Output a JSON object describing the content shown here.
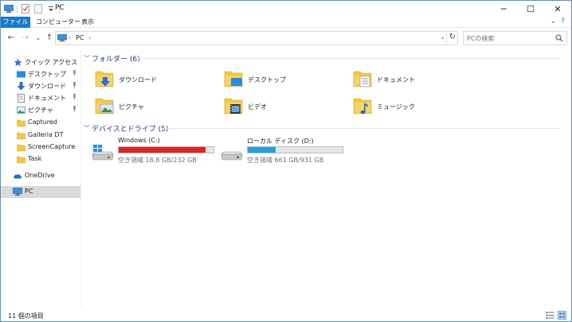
{
  "window": {
    "title": "PC",
    "controls": {
      "minimize": "─",
      "maximize": "☐",
      "close": "✕"
    }
  },
  "ribbon": {
    "tabs": [
      {
        "label": "ファイル"
      },
      {
        "label": "コンピューター"
      },
      {
        "label": "表示"
      }
    ],
    "expand": "⌄",
    "help": "?"
  },
  "address": {
    "nav": {
      "back": "←",
      "forward": "→",
      "recent": "⌄",
      "up": "↑"
    },
    "breadcrumb": [
      "›",
      "PC",
      "›"
    ],
    "dropdown": "⌄",
    "refresh": "↻"
  },
  "search": {
    "placeholder": "PCの検索"
  },
  "sidebar": {
    "quick_access": "クイック アクセス",
    "items": [
      {
        "label": "デスクトップ",
        "pinned": "📌"
      },
      {
        "label": "ダウンロード",
        "pinned": "📌"
      },
      {
        "label": "ドキュメント",
        "pinned": "📌"
      },
      {
        "label": "ピクチャ",
        "pinned": "📌"
      },
      {
        "label": "Captured"
      },
      {
        "label": "Galleria DT"
      },
      {
        "label": "ScreenCapture"
      },
      {
        "label": "Task"
      }
    ],
    "onedrive": "OneDrive",
    "pc": "PC"
  },
  "folders": {
    "header": "フォルダー (6)",
    "items": [
      {
        "label": "ダウンロード",
        "icon": "downloads-folder-icon"
      },
      {
        "label": "デスクトップ",
        "icon": "desktop-folder-icon"
      },
      {
        "label": "ドキュメント",
        "icon": "documents-folder-icon"
      },
      {
        "label": "ピクチャ",
        "icon": "pictures-folder-icon"
      },
      {
        "label": "ビデオ",
        "icon": "videos-folder-icon"
      },
      {
        "label": "ミュージック",
        "icon": "music-folder-icon"
      }
    ]
  },
  "drives": {
    "header": "デバイスとドライブ (5)",
    "items": [
      {
        "name": "Windows (C:)",
        "info": "空き領域 18.8 GB/232 GB",
        "used_fraction": 0.919,
        "color": "#da2626"
      },
      {
        "name": "ローカル ディスク (D:)",
        "info": "空き領域 661 GB/931 GB",
        "used_fraction": 0.29,
        "color": "#26a0da"
      }
    ]
  },
  "status": {
    "count": "11 個の項目"
  },
  "colors": {
    "accent": "#1979ca",
    "group_header": "#1e3287"
  }
}
